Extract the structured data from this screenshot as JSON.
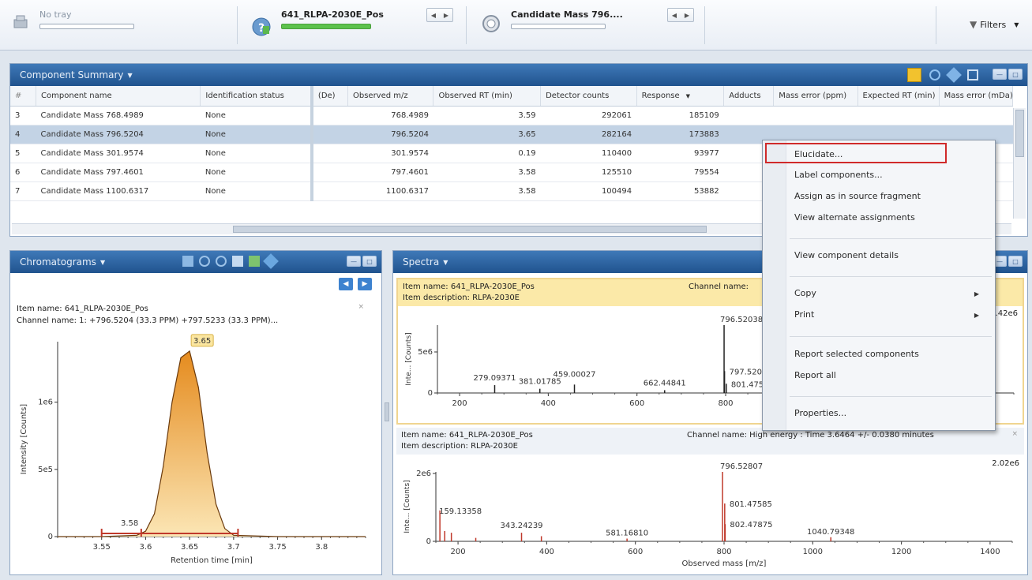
{
  "toolbar": {
    "tray_label": "No tray",
    "sample_name": "641_RLPA-2030E_Pos",
    "candidate_label": "Candidate Mass 796....",
    "filters_label": "Filters"
  },
  "component_summary": {
    "title": "Component Summary",
    "columns": [
      "Component name",
      "Identification status",
      "(De)",
      "Observed m/z",
      "Observed RT (min)",
      "Detector counts",
      "Response",
      "Adducts",
      "Mass error (ppm)",
      "Expected RT (min)",
      "Mass error (mDa)"
    ],
    "rows": [
      {
        "idx": "3",
        "name": "Candidate Mass 768.4989",
        "status": "None",
        "mz": "768.4989",
        "rt": "3.59",
        "counts": "292061",
        "response": "185109"
      },
      {
        "idx": "4",
        "name": "Candidate Mass 796.5204",
        "status": "None",
        "mz": "796.5204",
        "rt": "3.65",
        "counts": "282164",
        "response": "173883"
      },
      {
        "idx": "5",
        "name": "Candidate Mass 301.9574",
        "status": "None",
        "mz": "301.9574",
        "rt": "0.19",
        "counts": "110400",
        "response": "93977"
      },
      {
        "idx": "6",
        "name": "Candidate Mass 797.4601",
        "status": "None",
        "mz": "797.4601",
        "rt": "3.58",
        "counts": "125510",
        "response": "79554"
      },
      {
        "idx": "7",
        "name": "Candidate Mass 1100.6317",
        "status": "None",
        "mz": "1100.6317",
        "rt": "3.58",
        "counts": "100494",
        "response": "53882"
      }
    ]
  },
  "context_menu": {
    "items": [
      "Elucidate...",
      "Label components...",
      "Assign as in source fragment",
      "View alternate assignments",
      "View component details",
      "Copy",
      "Print",
      "Report selected components",
      "Report all",
      "Properties..."
    ]
  },
  "chromatograms": {
    "title": "Chromatograms",
    "item_name": "Item name: 641_RLPA-2030E_Pos",
    "channel_name": "Channel name: 1: +796.5204 (33.3 PPM) +797.5233 (33.3 PPM)...",
    "peak_label": "3.65",
    "minor_label": "3.58",
    "xlabel": "Retention time [min]",
    "ylabel": "Intensity [Counts]"
  },
  "spectra": {
    "title": "Spectra",
    "top": {
      "item_name": "Item name: 641_RLPA-2030E_Pos",
      "item_desc": "Item description: RLPA-2030E",
      "channel_name": "Channel name:",
      "max_label": "2.42e6"
    },
    "bottom": {
      "item_name": "Item name: 641_RLPA-2030E_Pos",
      "item_desc": "Item description: RLPA-2030E",
      "channel_name": "Channel name: High energy : Time 3.6464 +/- 0.0380 minutes",
      "max_label": "2.02e6",
      "xlabel": "Observed mass [m/z]"
    },
    "ylabel": "Inte... [Counts]"
  },
  "chart_data": [
    {
      "type": "line",
      "title": "",
      "xlabel": "Retention time [min]",
      "ylabel": "Intensity [Counts]",
      "xlim": [
        3.5,
        3.85
      ],
      "ylim": [
        0,
        1450000
      ],
      "x_ticks": [
        3.55,
        3.6,
        3.65,
        3.7,
        3.75,
        3.8
      ],
      "y_ticks": [
        "0",
        "5e5",
        "1e6"
      ],
      "x": [
        3.5,
        3.55,
        3.59,
        3.6,
        3.61,
        3.62,
        3.63,
        3.64,
        3.65,
        3.66,
        3.67,
        3.68,
        3.69,
        3.7,
        3.75,
        3.85
      ],
      "y": [
        0,
        0,
        10000,
        40000,
        170000,
        520000,
        1000000,
        1330000,
        1380000,
        1110000,
        620000,
        240000,
        60000,
        10000,
        0,
        0
      ],
      "annotations": [
        {
          "x": 3.65,
          "label": "3.65"
        },
        {
          "x": 3.58,
          "label": "3.58"
        }
      ]
    },
    {
      "type": "bar",
      "title": "",
      "xlabel": "",
      "ylabel": "Inte... [Counts]",
      "xlim": [
        150,
        1450
      ],
      "ylim": [
        0,
        2420000
      ],
      "x_ticks": [
        200,
        400,
        600,
        800
      ],
      "y_ticks": [
        "0",
        "5e6"
      ],
      "x": [
        279.09,
        381.02,
        459.0,
        662.45,
        796.52,
        797.52,
        801.47
      ],
      "values": [
        280000,
        150000,
        300000,
        100000,
        2420000,
        780000,
        330000
      ],
      "labels": [
        "279.09371",
        "381.01785",
        "459.00027",
        "662.44841",
        "796.52038",
        "797.520",
        "801.475"
      ]
    },
    {
      "type": "bar",
      "title": "",
      "xlabel": "Observed mass [m/z]",
      "ylabel": "Inte... [Counts]",
      "xlim": [
        150,
        1450
      ],
      "ylim": [
        0,
        2020000
      ],
      "x_ticks": [
        200,
        400,
        600,
        800,
        1000,
        1200,
        1400
      ],
      "y_ticks": [
        "0",
        "2e6"
      ],
      "x": [
        159.13,
        170,
        185,
        240,
        343.24,
        388,
        581.17,
        796.52,
        801.48,
        802.48,
        1040.79
      ],
      "values": [
        900000,
        300000,
        250000,
        100000,
        250000,
        150000,
        80000,
        2020000,
        1100000,
        500000,
        120000
      ],
      "labels": [
        "159.13358",
        "",
        "",
        "",
        "343.24239",
        "",
        "581.16810",
        "796.52807",
        "801.47585",
        "802.47875",
        "1040.79348"
      ]
    }
  ]
}
